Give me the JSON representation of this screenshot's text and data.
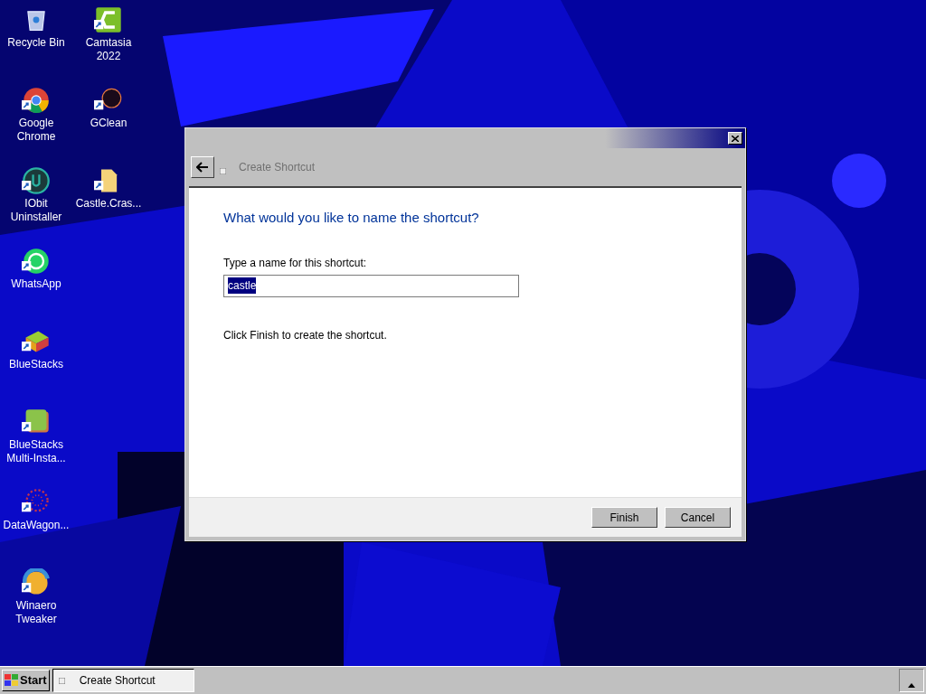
{
  "desktop_columns": [
    {
      "icons": [
        {
          "label": "Recycle Bin",
          "kind": "recycle"
        },
        {
          "label": "Google Chrome",
          "kind": "chrome"
        },
        {
          "label": "IObit Uninstaller",
          "kind": "iobit"
        },
        {
          "label": "WhatsApp",
          "kind": "whatsapp"
        },
        {
          "label": "BlueStacks",
          "kind": "bluestacks"
        },
        {
          "label": "BlueStacks Multi-Insta...",
          "kind": "multi"
        },
        {
          "label": "DataWagon...",
          "kind": "datawagon"
        },
        {
          "label": "Winaero Tweaker",
          "kind": "winaero"
        }
      ]
    },
    {
      "icons": [
        {
          "label": "Camtasia 2022",
          "kind": "camtasia"
        },
        {
          "label": "GClean",
          "kind": "gclean"
        },
        {
          "label": "Castle.Cras...",
          "kind": "file"
        }
      ]
    }
  ],
  "dialog": {
    "title": "Create Shortcut",
    "heading": "What would you like to name the shortcut?",
    "field_label": "Type a name for this shortcut:",
    "field_value": "castle",
    "hint": "Click Finish to create the shortcut.",
    "buttons": [
      "Finish",
      "Cancel"
    ]
  },
  "taskbar": {
    "start": "Start",
    "tasks": [
      {
        "label": "Create Shortcut"
      }
    ]
  }
}
